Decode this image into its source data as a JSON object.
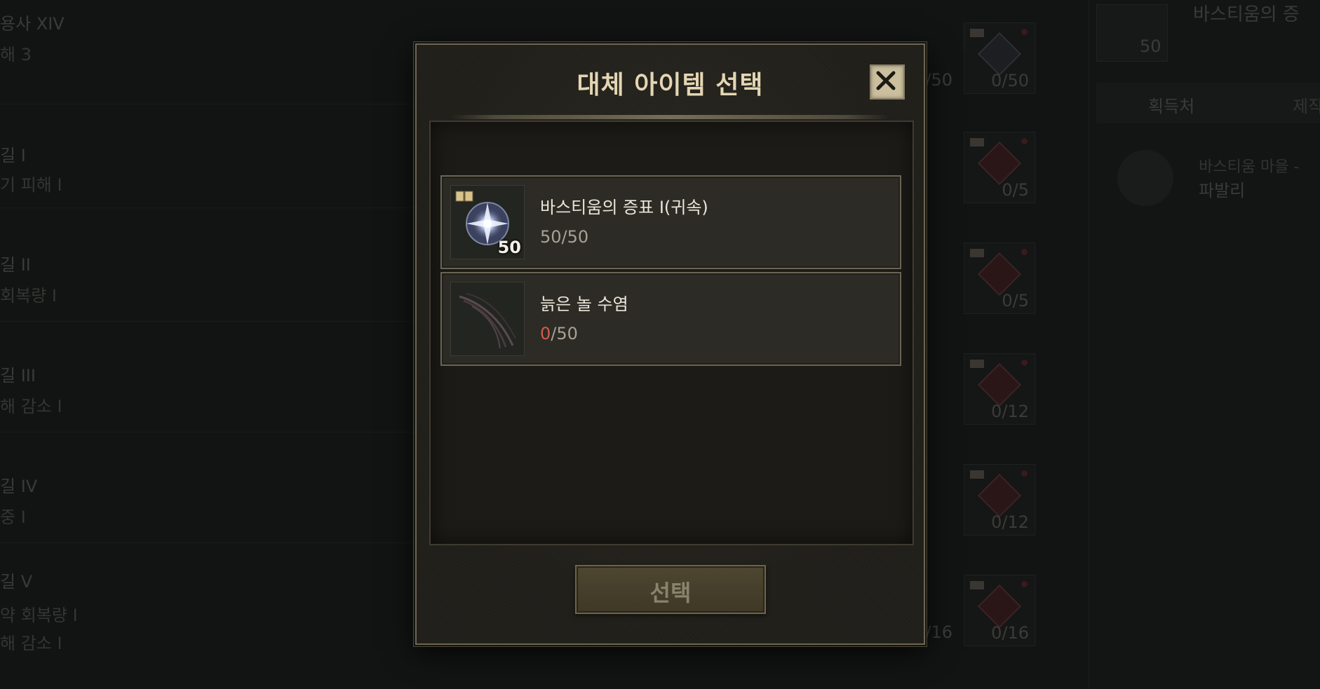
{
  "background": {
    "left_rows": [
      {
        "line1": "용사 XIV",
        "line2": "해 3",
        "line3": ""
      },
      {
        "line1": "길 I",
        "line2": "기 피해 I",
        "line3": ""
      },
      {
        "line1": "길 II",
        "line2": "회복량 I",
        "line3": ""
      },
      {
        "line1": "길 III",
        "line2": "해 감소 I",
        "line3": ""
      },
      {
        "line1": "길 IV",
        "line2": "중 I",
        "line3": ""
      },
      {
        "line1": "길 V",
        "line2": "약 회복량 I",
        "line3": "해 감소 I"
      }
    ],
    "slot_counts": [
      "0/50",
      "0/5",
      "0/5",
      "0/12",
      "0/12",
      "0/16"
    ],
    "partial_counts": [
      "/50",
      "/16"
    ],
    "right_panel": {
      "title": "바스티움의 증",
      "icon_count": "50",
      "tab_source": "획득처",
      "tab_craft": "제작",
      "source_sub": "바스티움 마을 -",
      "source_name": "파발리"
    }
  },
  "modal": {
    "title": "대체 아이템 선택",
    "close_icon": "close-x-icon",
    "items": [
      {
        "name": "바스티움의 증표 I(귀속)",
        "icon": "bastium-token-icon",
        "stack_count": "50",
        "have": "50",
        "need": "/50"
      },
      {
        "name": "늙은 놀 수염",
        "icon": "old-gnoll-whisker-icon",
        "stack_count": "",
        "have": "0",
        "need": "/50"
      }
    ],
    "select_label": "선택"
  },
  "colors": {
    "title_gold": "#e4d6b4",
    "zero_red": "#d45a4f",
    "close_bg": "#cbbf9e"
  }
}
